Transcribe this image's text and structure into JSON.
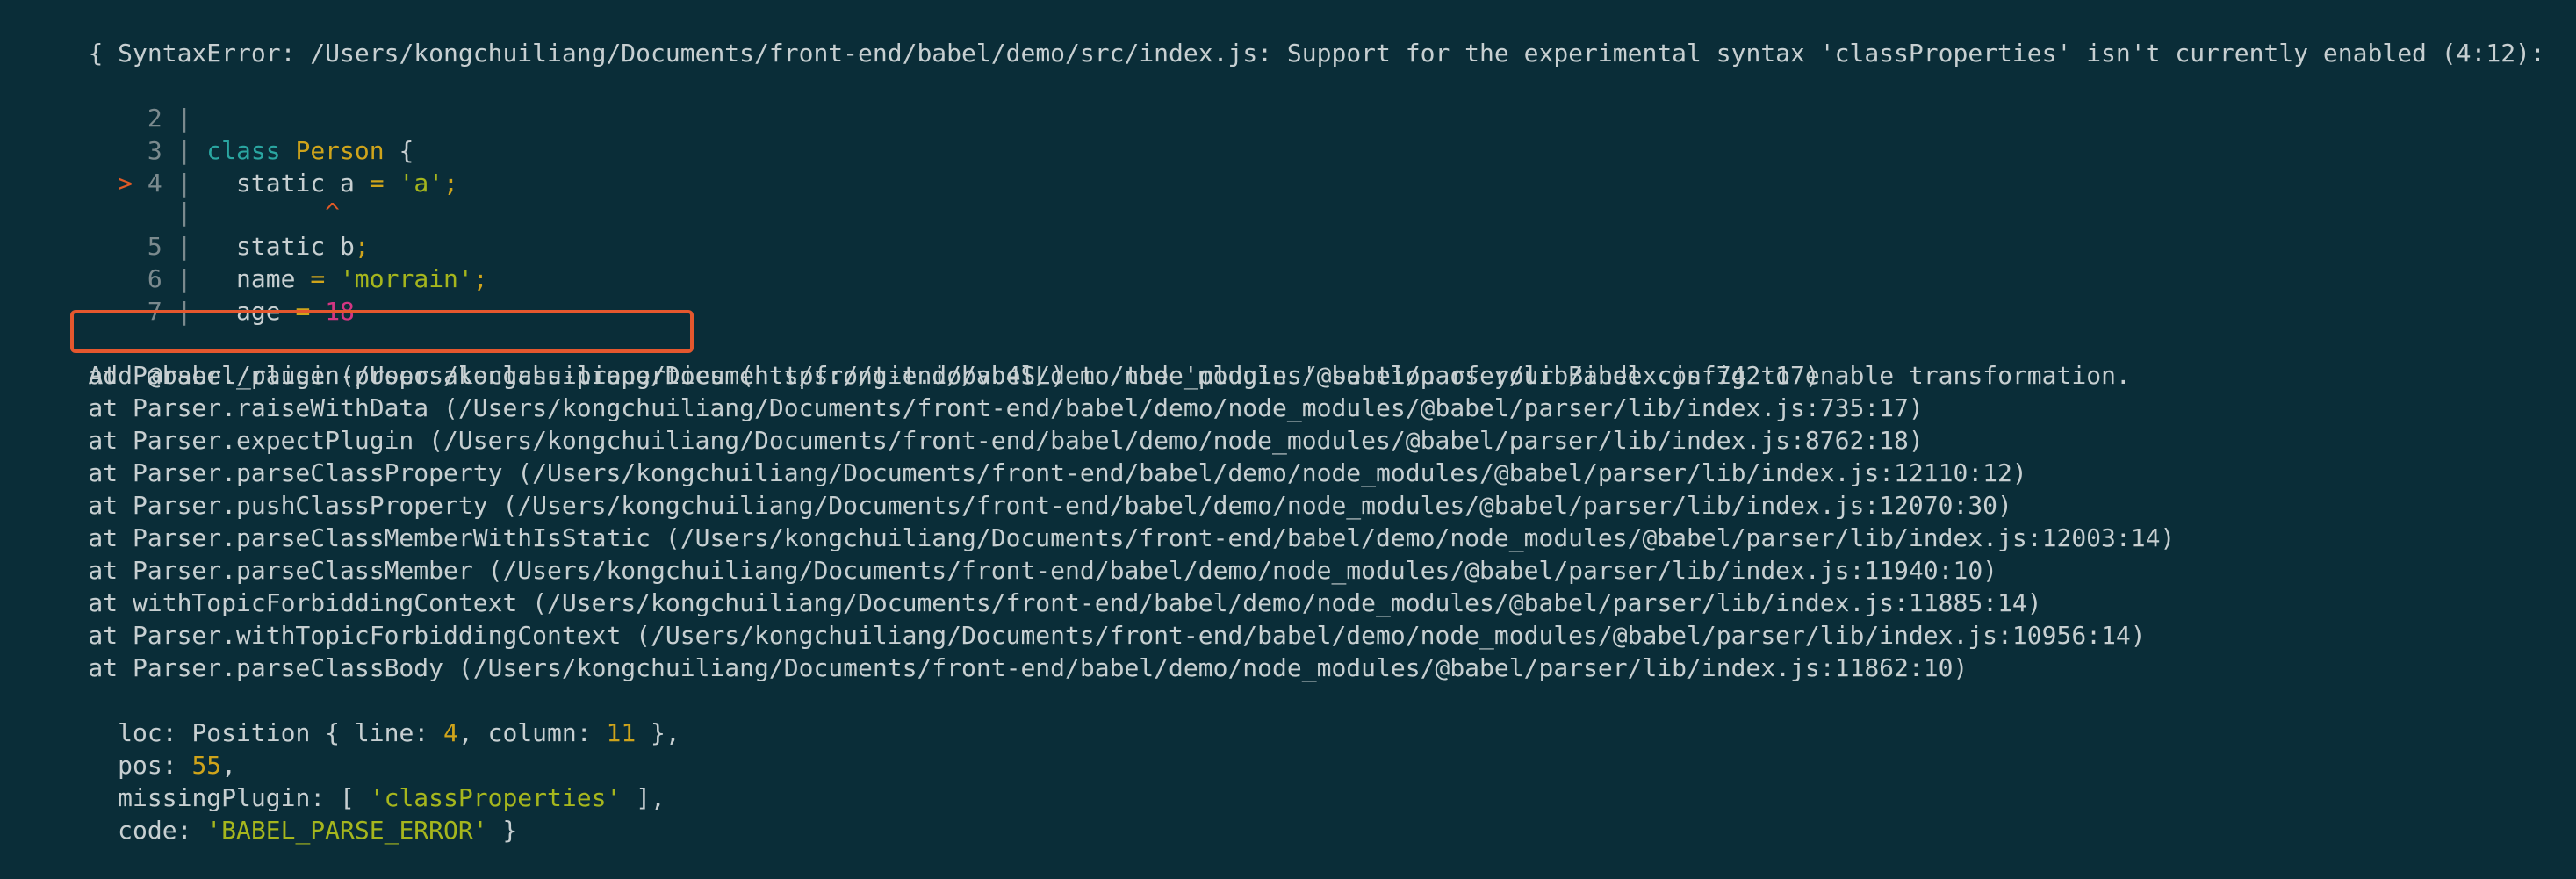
{
  "error_header": "{ SyntaxError: /Users/kongchuiliang/Documents/front-end/babel/demo/src/index.js: Support for the experimental syntax 'classProperties' isn't currently enabled (4:12):",
  "code_frame": {
    "lines": [
      {
        "marker": "",
        "num": "2",
        "sep": "|",
        "code": ""
      },
      {
        "marker": "",
        "num": "3",
        "sep": "|",
        "kw": "class",
        "cls": "Person",
        "rest": " {"
      },
      {
        "marker": ">",
        "num": "4",
        "sep": "|",
        "pre": "  static a ",
        "op": "=",
        "str": "'a'",
        "semi": ";"
      },
      {
        "caret": "^"
      },
      {
        "marker": "",
        "num": "5",
        "sep": "|",
        "pre": "  static b",
        "semi": ";"
      },
      {
        "marker": "",
        "num": "6",
        "sep": "|",
        "pre": "  name ",
        "op": "=",
        "str": "'morrain'",
        "semi": ";"
      },
      {
        "marker": "",
        "num": "7",
        "sep": "|",
        "pre": "  age ",
        "op": "=",
        "num_val": "18"
      }
    ]
  },
  "hint": {
    "prefix": "Add ",
    "plugin": "@babel/plugin-proposal-class-properties",
    "suffix": " (https://git.io/vb4SL) to the 'plugins' section of your Babel config to enable transformation."
  },
  "stack": [
    "    at Parser._raise (/Users/kongchuiliang/Documents/front-end/babel/demo/node_modules/@babel/parser/lib/index.js:742:17)",
    "    at Parser.raiseWithData (/Users/kongchuiliang/Documents/front-end/babel/demo/node_modules/@babel/parser/lib/index.js:735:17)",
    "    at Parser.expectPlugin (/Users/kongchuiliang/Documents/front-end/babel/demo/node_modules/@babel/parser/lib/index.js:8762:18)",
    "    at Parser.parseClassProperty (/Users/kongchuiliang/Documents/front-end/babel/demo/node_modules/@babel/parser/lib/index.js:12110:12)",
    "    at Parser.pushClassProperty (/Users/kongchuiliang/Documents/front-end/babel/demo/node_modules/@babel/parser/lib/index.js:12070:30)",
    "    at Parser.parseClassMemberWithIsStatic (/Users/kongchuiliang/Documents/front-end/babel/demo/node_modules/@babel/parser/lib/index.js:12003:14)",
    "    at Parser.parseClassMember (/Users/kongchuiliang/Documents/front-end/babel/demo/node_modules/@babel/parser/lib/index.js:11940:10)",
    "    at withTopicForbiddingContext (/Users/kongchuiliang/Documents/front-end/babel/demo/node_modules/@babel/parser/lib/index.js:11885:14)",
    "    at Parser.withTopicForbiddingContext (/Users/kongchuiliang/Documents/front-end/babel/demo/node_modules/@babel/parser/lib/index.js:10956:14)",
    "    at Parser.parseClassBody (/Users/kongchuiliang/Documents/front-end/babel/demo/node_modules/@babel/parser/lib/index.js:11862:10)"
  ],
  "props": {
    "loc_key": "  loc: ",
    "loc_pre": "Position { line: ",
    "loc_line": "4",
    "loc_mid": ", column: ",
    "loc_col": "11",
    "loc_post": " },",
    "pos_key": "  pos: ",
    "pos_val": "55",
    "pos_post": ",",
    "missing_key": "  missingPlugin: [ ",
    "missing_val": "'classProperties'",
    "missing_post": " ],",
    "code_key": "  code: ",
    "code_val": "'BABEL_PARSE_ERROR'",
    "code_post": " }"
  }
}
